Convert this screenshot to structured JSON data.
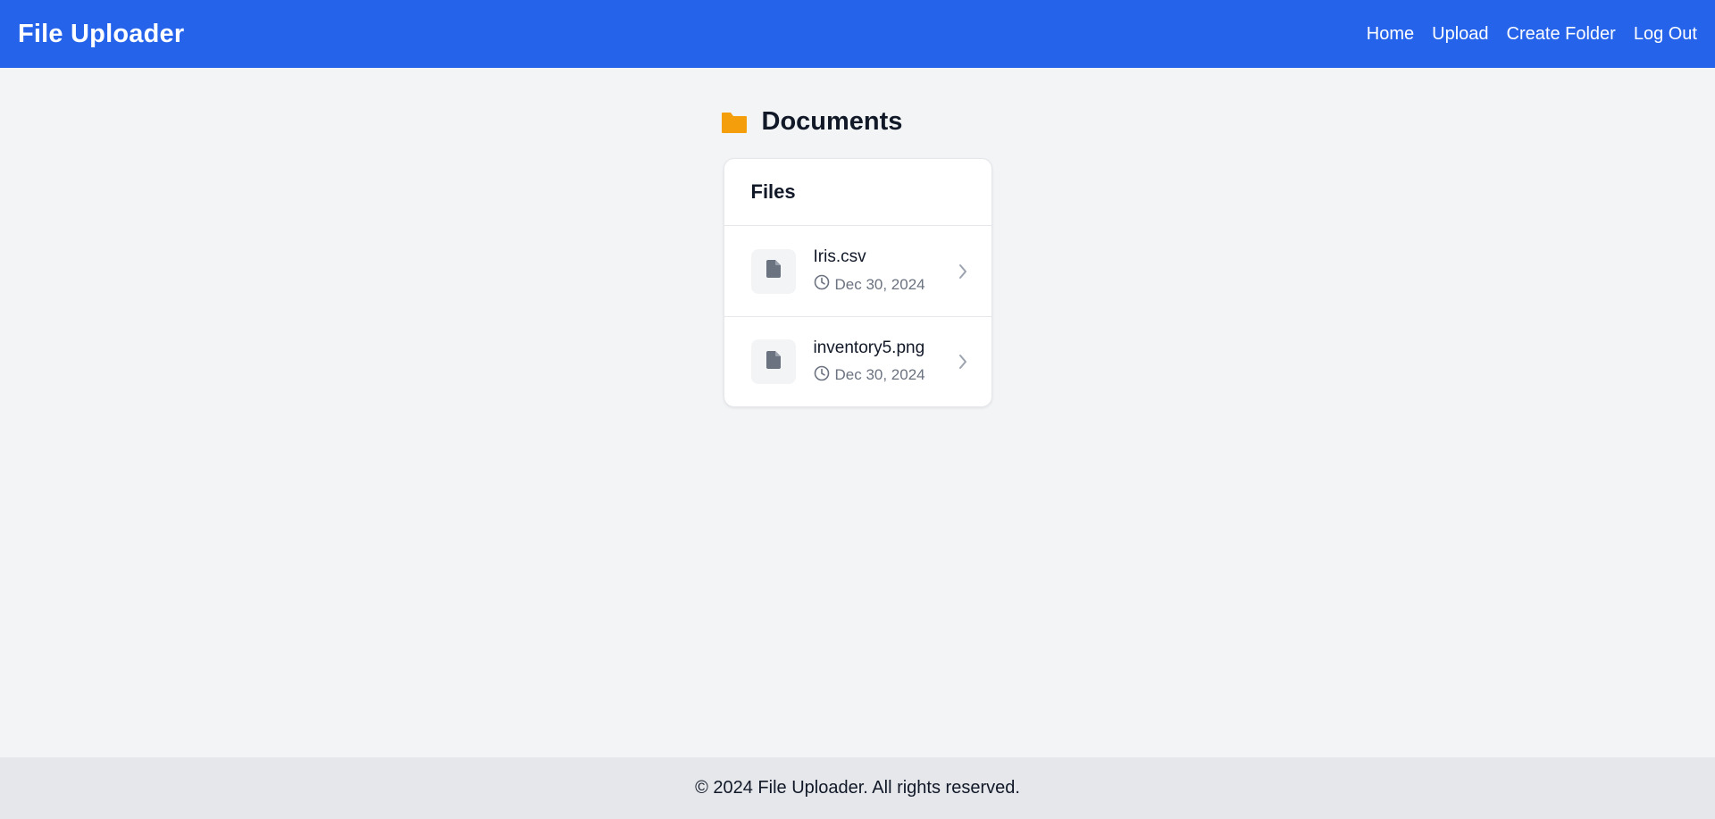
{
  "app": {
    "brand": "File Uploader"
  },
  "nav": {
    "items": [
      {
        "label": "Home",
        "name": "nav-home"
      },
      {
        "label": "Upload",
        "name": "nav-upload"
      },
      {
        "label": "Create Folder",
        "name": "nav-create-folder"
      },
      {
        "label": "Log Out",
        "name": "nav-log-out"
      }
    ]
  },
  "folder": {
    "title": "Documents",
    "icon": "folder-icon",
    "icon_color": "#f59e0b"
  },
  "files_card": {
    "title": "Files",
    "files": [
      {
        "name": "Iris.csv",
        "date": "Dec 30, 2024",
        "icon": "file-icon"
      },
      {
        "name": "inventory5.png",
        "date": "Dec 30, 2024",
        "icon": "file-icon"
      }
    ]
  },
  "footer": {
    "text": "© 2024 File Uploader. All rights reserved."
  },
  "colors": {
    "header_bg": "#2563eb",
    "page_bg": "#f3f4f6",
    "footer_bg": "#e5e7eb",
    "muted_text": "#6b7280",
    "icon_gray": "#6b7280"
  }
}
